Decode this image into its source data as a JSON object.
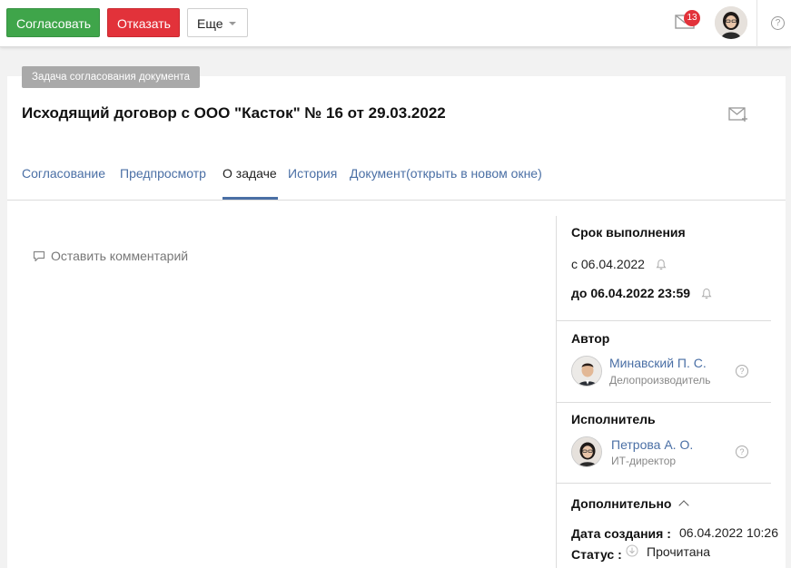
{
  "toolbar": {
    "approve_label": "Согласовать",
    "reject_label": "Отказать",
    "more_label": "Еще",
    "notification_count": "13",
    "help_glyph": "?"
  },
  "task_type": "Задача согласования документа",
  "document_title": "Исходящий договор с ООО \"Касток\" № 16 от 29.03.2022",
  "tabs": [
    {
      "label": "Согласование"
    },
    {
      "label": "Предпросмотр"
    },
    {
      "label": "О задаче"
    },
    {
      "label": "История"
    },
    {
      "label": "Документ(открыть в новом окне)"
    }
  ],
  "active_tab": "О задаче",
  "comment_link": "Оставить комментарий",
  "deadline": {
    "title": "Срок выполнения",
    "from": "с 06.04.2022",
    "to": "до 06.04.2022 23:59"
  },
  "author": {
    "title": "Автор",
    "name": "Минавский П. С.",
    "role": "Делопроизводитель"
  },
  "executor": {
    "title": "Исполнитель",
    "name": "Петрова А. О.",
    "role": "ИТ-директор"
  },
  "additional": {
    "title": "Дополнительно",
    "created_label": "Дата создания :",
    "created_value": "06.04.2022 10:26",
    "status_label": "Статус :",
    "status_value": "Прочитана"
  },
  "colors": {
    "approve": "#3fa54a",
    "reject": "#e2323a",
    "link": "#4a6fa5",
    "badge": "#e2323a"
  }
}
